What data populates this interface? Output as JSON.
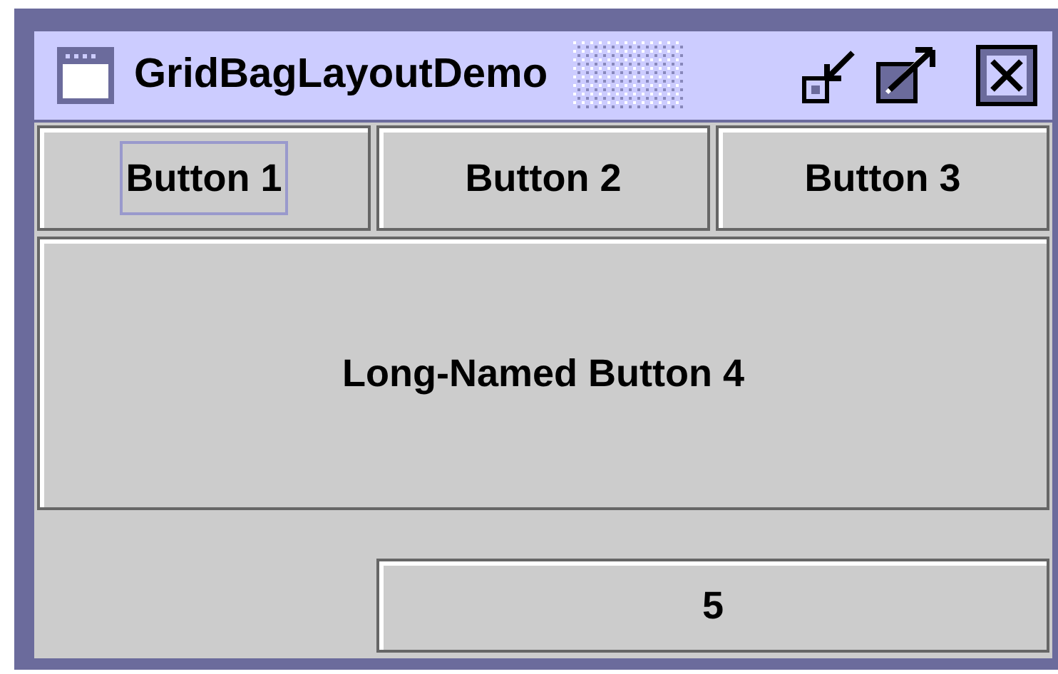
{
  "window": {
    "title": "GridBagLayoutDemo"
  },
  "buttons": [
    {
      "label": "Button 1",
      "focused": true
    },
    {
      "label": "Button 2",
      "focused": false
    },
    {
      "label": "Button 3",
      "focused": false
    },
    {
      "label": "Long-Named Button 4",
      "focused": false
    },
    {
      "label": "5",
      "focused": false
    }
  ]
}
